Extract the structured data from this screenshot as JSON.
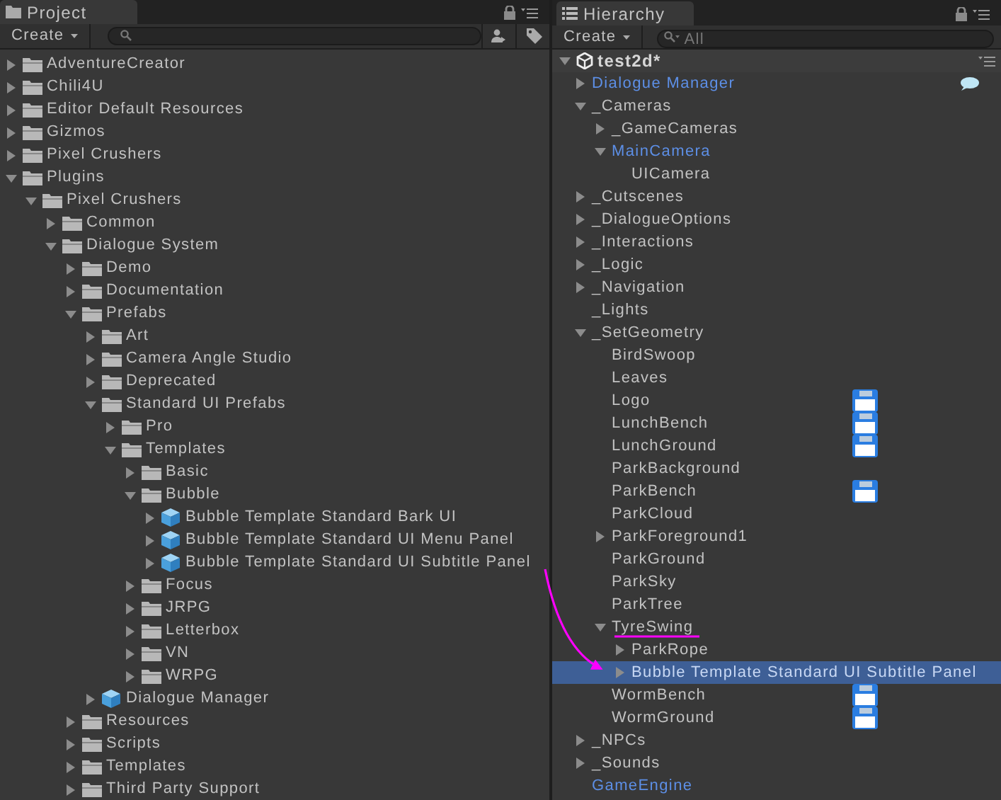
{
  "project": {
    "tab": "Project",
    "create_button": "Create",
    "tree": [
      {
        "label": "AdventureCreator",
        "kind": "folder",
        "expanded": false
      },
      {
        "label": "Chili4U",
        "kind": "folder",
        "expanded": false
      },
      {
        "label": "Editor Default Resources",
        "kind": "folder",
        "expanded": false
      },
      {
        "label": "Gizmos",
        "kind": "folder",
        "expanded": false
      },
      {
        "label": "Pixel Crushers",
        "kind": "folder",
        "expanded": false
      },
      {
        "label": "Plugins",
        "kind": "folder",
        "expanded": true,
        "children": [
          {
            "label": "Pixel Crushers",
            "kind": "folder",
            "expanded": true,
            "children": [
              {
                "label": "Common",
                "kind": "folder",
                "expanded": false
              },
              {
                "label": "Dialogue System",
                "kind": "folder",
                "expanded": true,
                "children": [
                  {
                    "label": "Demo",
                    "kind": "folder",
                    "expanded": false
                  },
                  {
                    "label": "Documentation",
                    "kind": "folder",
                    "expanded": false
                  },
                  {
                    "label": "Prefabs",
                    "kind": "folder",
                    "expanded": true,
                    "children": [
                      {
                        "label": "Art",
                        "kind": "folder",
                        "expanded": false
                      },
                      {
                        "label": "Camera Angle Studio",
                        "kind": "folder",
                        "expanded": false
                      },
                      {
                        "label": "Deprecated",
                        "kind": "folder",
                        "expanded": false
                      },
                      {
                        "label": "Standard UI Prefabs",
                        "kind": "folder",
                        "expanded": true,
                        "children": [
                          {
                            "label": "Pro",
                            "kind": "folder",
                            "expanded": false
                          },
                          {
                            "label": "Templates",
                            "kind": "folder",
                            "expanded": true,
                            "children": [
                              {
                                "label": "Basic",
                                "kind": "folder",
                                "expanded": false
                              },
                              {
                                "label": "Bubble",
                                "kind": "folder",
                                "expanded": true,
                                "children": [
                                  {
                                    "label": "Bubble Template Standard Bark UI",
                                    "kind": "prefab",
                                    "expanded": false
                                  },
                                  {
                                    "label": "Bubble Template Standard UI Menu Panel",
                                    "kind": "prefab",
                                    "expanded": false
                                  },
                                  {
                                    "label": "Bubble Template Standard UI Subtitle Panel",
                                    "kind": "prefab",
                                    "expanded": false
                                  }
                                ]
                              },
                              {
                                "label": "Focus",
                                "kind": "folder",
                                "expanded": false
                              },
                              {
                                "label": "JRPG",
                                "kind": "folder",
                                "expanded": false
                              },
                              {
                                "label": "Letterbox",
                                "kind": "folder",
                                "expanded": false
                              },
                              {
                                "label": "VN",
                                "kind": "folder",
                                "expanded": false
                              },
                              {
                                "label": "WRPG",
                                "kind": "folder",
                                "expanded": false
                              }
                            ]
                          }
                        ]
                      },
                      {
                        "label": "Dialogue Manager",
                        "kind": "prefab",
                        "expanded": false
                      }
                    ]
                  },
                  {
                    "label": "Resources",
                    "kind": "folder",
                    "expanded": false
                  },
                  {
                    "label": "Scripts",
                    "kind": "folder",
                    "expanded": false
                  },
                  {
                    "label": "Templates",
                    "kind": "folder",
                    "expanded": false
                  },
                  {
                    "label": "Third Party Support",
                    "kind": "folder",
                    "expanded": false
                  }
                ]
              }
            ]
          }
        ]
      }
    ]
  },
  "hierarchy": {
    "tab": "Hierarchy",
    "create_button": "Create",
    "search": {
      "placeholder": "All"
    },
    "scene": {
      "name": "test2d*",
      "expanded": true
    },
    "items": [
      {
        "label": "Dialogue Manager",
        "prefab": true,
        "expanded": false,
        "chat_badge": true,
        "selected": false
      },
      {
        "label": "_Cameras",
        "prefab": false,
        "expanded": true,
        "selected": false,
        "children": [
          {
            "label": "_GameCameras",
            "prefab": false,
            "expanded": false,
            "selected": false
          },
          {
            "label": "MainCamera",
            "prefab": true,
            "expanded": true,
            "selected": false,
            "children": [
              {
                "label": "UICamera",
                "prefab": false,
                "selected": false
              }
            ]
          }
        ]
      },
      {
        "label": "_Cutscenes",
        "prefab": false,
        "expanded": false,
        "selected": false
      },
      {
        "label": "_DialogueOptions",
        "prefab": false,
        "expanded": false,
        "selected": false
      },
      {
        "label": "_Interactions",
        "prefab": false,
        "expanded": false,
        "selected": false
      },
      {
        "label": "_Logic",
        "prefab": false,
        "expanded": false,
        "selected": false
      },
      {
        "label": "_Navigation",
        "prefab": false,
        "expanded": false,
        "selected": false
      },
      {
        "label": "_Lights",
        "prefab": false,
        "selected": false
      },
      {
        "label": "_SetGeometry",
        "prefab": false,
        "expanded": true,
        "selected": false,
        "children": [
          {
            "label": "BirdSwoop",
            "prefab": false,
            "selected": false
          },
          {
            "label": "Leaves",
            "prefab": false,
            "selected": false
          },
          {
            "label": "Logo",
            "prefab": false,
            "disk_badge": true,
            "selected": false
          },
          {
            "label": "LunchBench",
            "prefab": false,
            "disk_badge": true,
            "selected": false
          },
          {
            "label": "LunchGround",
            "prefab": false,
            "disk_badge": true,
            "selected": false
          },
          {
            "label": "ParkBackground",
            "prefab": false,
            "selected": false
          },
          {
            "label": "ParkBench",
            "prefab": false,
            "disk_badge": true,
            "selected": false
          },
          {
            "label": "ParkCloud",
            "prefab": false,
            "selected": false
          },
          {
            "label": "ParkForeground1",
            "prefab": false,
            "expanded": false,
            "selected": false
          },
          {
            "label": "ParkGround",
            "prefab": false,
            "selected": false
          },
          {
            "label": "ParkSky",
            "prefab": false,
            "selected": false
          },
          {
            "label": "ParkTree",
            "prefab": false,
            "selected": false
          },
          {
            "label": "TyreSwing",
            "prefab": false,
            "expanded": true,
            "selected": false,
            "children": [
              {
                "label": "ParkRope",
                "prefab": false,
                "expanded": false,
                "selected": false
              },
              {
                "label": "Bubble Template Standard UI Subtitle Panel",
                "prefab": true,
                "expanded": false,
                "selected": true
              }
            ]
          },
          {
            "label": "WormBench",
            "prefab": false,
            "disk_badge": true,
            "selected": false
          },
          {
            "label": "WormGround",
            "prefab": false,
            "disk_badge": true,
            "selected": false
          }
        ]
      },
      {
        "label": "_NPCs",
        "prefab": false,
        "expanded": false,
        "selected": false
      },
      {
        "label": "_Sounds",
        "prefab": false,
        "expanded": false,
        "selected": false
      },
      {
        "label": "GameEngine",
        "prefab": true,
        "selected": false
      }
    ]
  }
}
